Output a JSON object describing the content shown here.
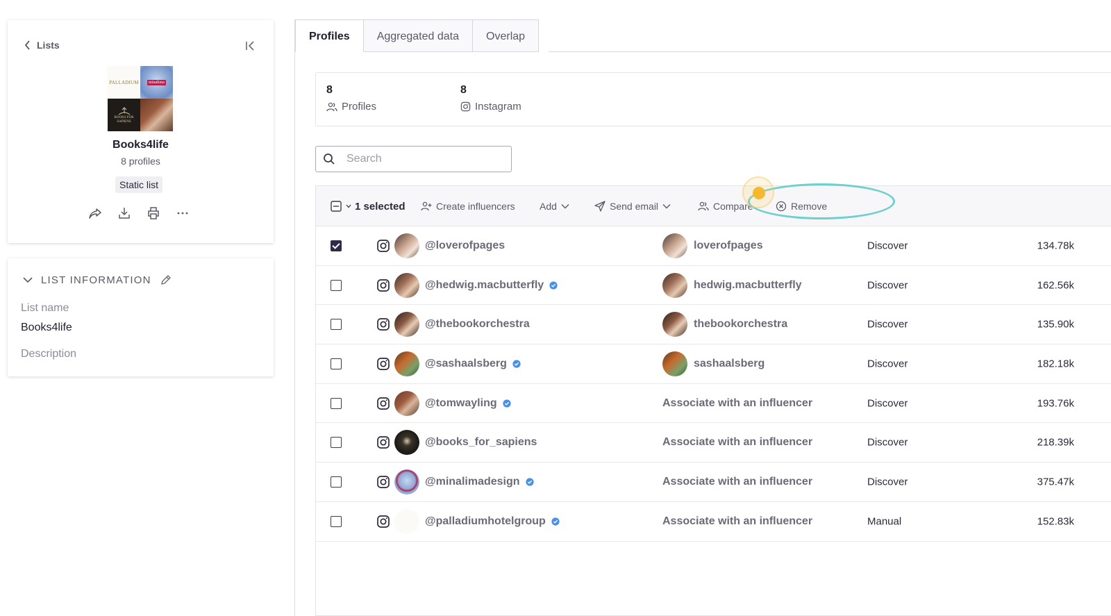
{
  "sidebar": {
    "back_label": "Lists",
    "list_title": "Books4life",
    "list_count": "8 profiles",
    "list_type": "Static list",
    "mosaic": {
      "palladium_text": "PALLADIUM",
      "minalima_text": "minalima",
      "books_text": "BOOKS FOR SAPIENS"
    },
    "info": {
      "header": "LIST INFORMATION",
      "name_label": "List name",
      "name_value": "Books4life",
      "description_label": "Description"
    }
  },
  "tabs": [
    {
      "label": "Profiles",
      "active": true
    },
    {
      "label": "Aggregated data",
      "active": false
    },
    {
      "label": "Overlap",
      "active": false
    }
  ],
  "stats": [
    {
      "value": "8",
      "label": "Profiles",
      "icon": "users-icon"
    },
    {
      "value": "8",
      "label": "Instagram",
      "icon": "instagram-icon"
    }
  ],
  "search": {
    "placeholder": "Search",
    "value": ""
  },
  "toolbar": {
    "selected_label": "1 selected",
    "create_label": "Create influencers",
    "add_label": "Add",
    "send_email_label": "Send email",
    "compare_label": "Compare",
    "remove_label": "Remove"
  },
  "rows": [
    {
      "checked": true,
      "handle": "@loverofpages",
      "verified": false,
      "influencer": "loverofpages",
      "linked": true,
      "source": "Discover",
      "followers": "134.78k"
    },
    {
      "checked": false,
      "handle": "@hedwig.macbutterfly",
      "verified": true,
      "influencer": "hedwig.macbutterfly",
      "linked": true,
      "source": "Discover",
      "followers": "162.56k"
    },
    {
      "checked": false,
      "handle": "@thebookorchestra",
      "verified": false,
      "influencer": "thebookorchestra",
      "linked": true,
      "source": "Discover",
      "followers": "135.90k"
    },
    {
      "checked": false,
      "handle": "@sashaalsberg",
      "verified": true,
      "influencer": "sashaalsberg",
      "linked": true,
      "source": "Discover",
      "followers": "182.18k"
    },
    {
      "checked": false,
      "handle": "@tomwayling",
      "verified": true,
      "influencer": "Associate with an influencer",
      "linked": false,
      "source": "Discover",
      "followers": "193.76k"
    },
    {
      "checked": false,
      "handle": "@books_for_sapiens",
      "verified": false,
      "influencer": "Associate with an influencer",
      "linked": false,
      "source": "Discover",
      "followers": "218.39k"
    },
    {
      "checked": false,
      "handle": "@minalimadesign",
      "verified": true,
      "influencer": "Associate with an influencer",
      "linked": false,
      "source": "Discover",
      "followers": "375.47k"
    },
    {
      "checked": false,
      "handle": "@palladiumhotelgroup",
      "verified": true,
      "influencer": "Associate with an influencer",
      "linked": false,
      "source": "Manual",
      "followers": "152.83k"
    }
  ],
  "colors": {
    "accent_dark": "#2e2b4a",
    "verified_blue": "#4a8fe8",
    "highlight_ring": "#6ecfcf",
    "cursor": "#f5b82e"
  }
}
